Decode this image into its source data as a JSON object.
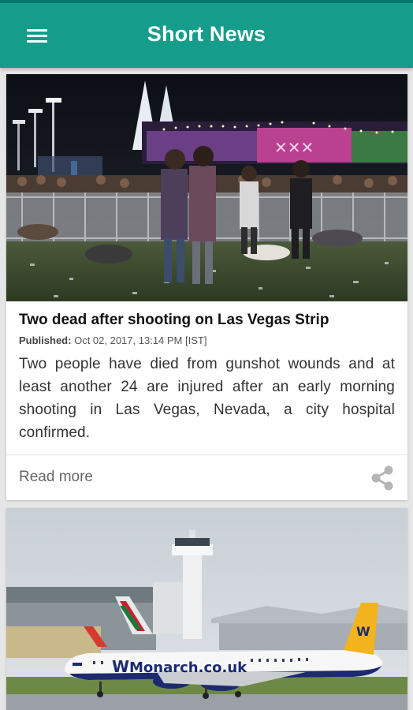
{
  "app": {
    "title": "Short News"
  },
  "icons": {
    "menu": "menu-icon",
    "share": "share-icon"
  },
  "colors": {
    "appbar": "#169c8a",
    "statusbar": "#00796b",
    "background": "#e6e6e6"
  },
  "feed": {
    "items": [
      {
        "headline": "Two dead after shooting on Las Vegas Strip",
        "published_label": "Published:",
        "published_value": "Oct 02, 2017, 13:14 PM [IST]",
        "summary": "Two people have died from gunshot wounds and at least another 24 are injured after an early morning shooting in Las Vegas, Nevada, a city hospital confirmed.",
        "read_more": "Read more"
      },
      {
        "image_text": "Monarch.co.uk"
      }
    ]
  }
}
